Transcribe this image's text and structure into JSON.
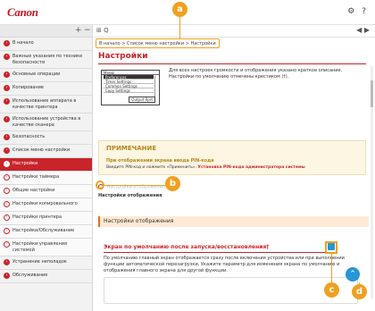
{
  "header": {
    "logo": "Canon",
    "icons": [
      "gear-icon",
      "help-icon"
    ]
  },
  "sidebar": {
    "tools_left": "+",
    "tools_right": "−",
    "items": [
      {
        "label": "В начало",
        "type": "normal"
      },
      {
        "label": "Важные указания по технике безопасности",
        "type": "normal"
      },
      {
        "label": "Основные операции",
        "type": "normal"
      },
      {
        "label": "Копирование",
        "type": "normal"
      },
      {
        "label": "Использование аппарата в качестве принтера",
        "type": "normal"
      },
      {
        "label": "Использование устройства в качестве сканера",
        "type": "normal"
      },
      {
        "label": "Безопасность",
        "type": "normal"
      },
      {
        "label": "Список меню настройки",
        "type": "normal"
      },
      {
        "label": "Настройки",
        "type": "active"
      },
      {
        "label": "Настройки таймера",
        "type": "sub"
      },
      {
        "label": "Общие настройки",
        "type": "sub"
      },
      {
        "label": "Настройки копировального",
        "type": "sub"
      },
      {
        "label": "Настройки принтера",
        "type": "sub"
      },
      {
        "label": "Настройки/Обслуживание",
        "type": "sub"
      },
      {
        "label": "Настройки управления системой",
        "type": "sub"
      },
      {
        "label": "Устранение неполадок",
        "type": "normal"
      },
      {
        "label": "Обслуживание",
        "type": "normal"
      }
    ]
  },
  "main": {
    "toolbar_left": "⊞ Q",
    "toolbar_right": "◀ ▶",
    "breadcrumb": "В начало > Список меню настройки > Настройки",
    "title": "Настройки",
    "screen": {
      "head": "Меню",
      "rows": [
        "Preferences",
        "Timer Settings",
        "Common Settings",
        "Copy Settings"
      ],
      "button": "Output Rprt"
    },
    "intro": "Для всех настроек громкости и отображения указано краткое описание. Настройки по умолчанию отмечены крестиком (†).",
    "note": {
      "title": "ПРИМЕЧАНИЕ",
      "subtitle": "При отображении экрана ввода PIN-кода",
      "text_prefix": "Введите PIN-код и нажмите «Применить».",
      "text_link": "Установка PIN-кода администратора системы"
    },
    "link_row1": "Настройки отображения",
    "link_row2": "Настройки отображения",
    "section_title": "Настройки отображения",
    "subsection_title": "Экран по умолчанию после запуска/восстановления†",
    "subsection_text": "По умолчанию главный экран отображается сразу после включения устройства или при выполнении функции автоматической перезагрузки. Укажите параметр для изменения экрана по умолчанию и отображения главного экрана для другой функции.",
    "top_button": "⌃"
  },
  "callouts": [
    "a",
    "b",
    "c",
    "d"
  ]
}
